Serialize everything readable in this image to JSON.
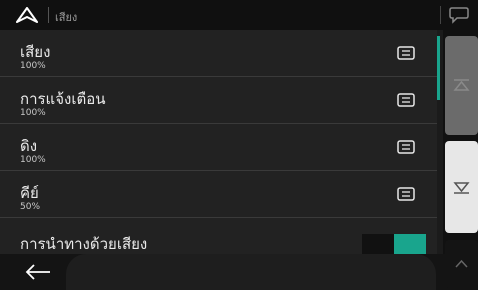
{
  "header": {
    "title": "เสียง",
    "logo_icon": "navigation-arrow-icon",
    "chat_icon": "speech-bubble-icon"
  },
  "settings": [
    {
      "label": "เสียง",
      "value": "100%"
    },
    {
      "label": "การแจ้งเตือน",
      "value": "100%"
    },
    {
      "label": "ดิง",
      "value": "100%"
    },
    {
      "label": "คีย์",
      "value": "50%"
    }
  ],
  "voice_guidance": {
    "label": "การนำทางด้วยเสียง",
    "enabled": true
  },
  "colors": {
    "accent": "#19a58d",
    "background": "#222222"
  },
  "icons": {
    "row_menu": "menu-lines-icon",
    "scroll_up": "scroll-up-icon",
    "scroll_down": "scroll-down-icon",
    "back": "back-arrow-icon",
    "top": "chevron-up-icon"
  }
}
